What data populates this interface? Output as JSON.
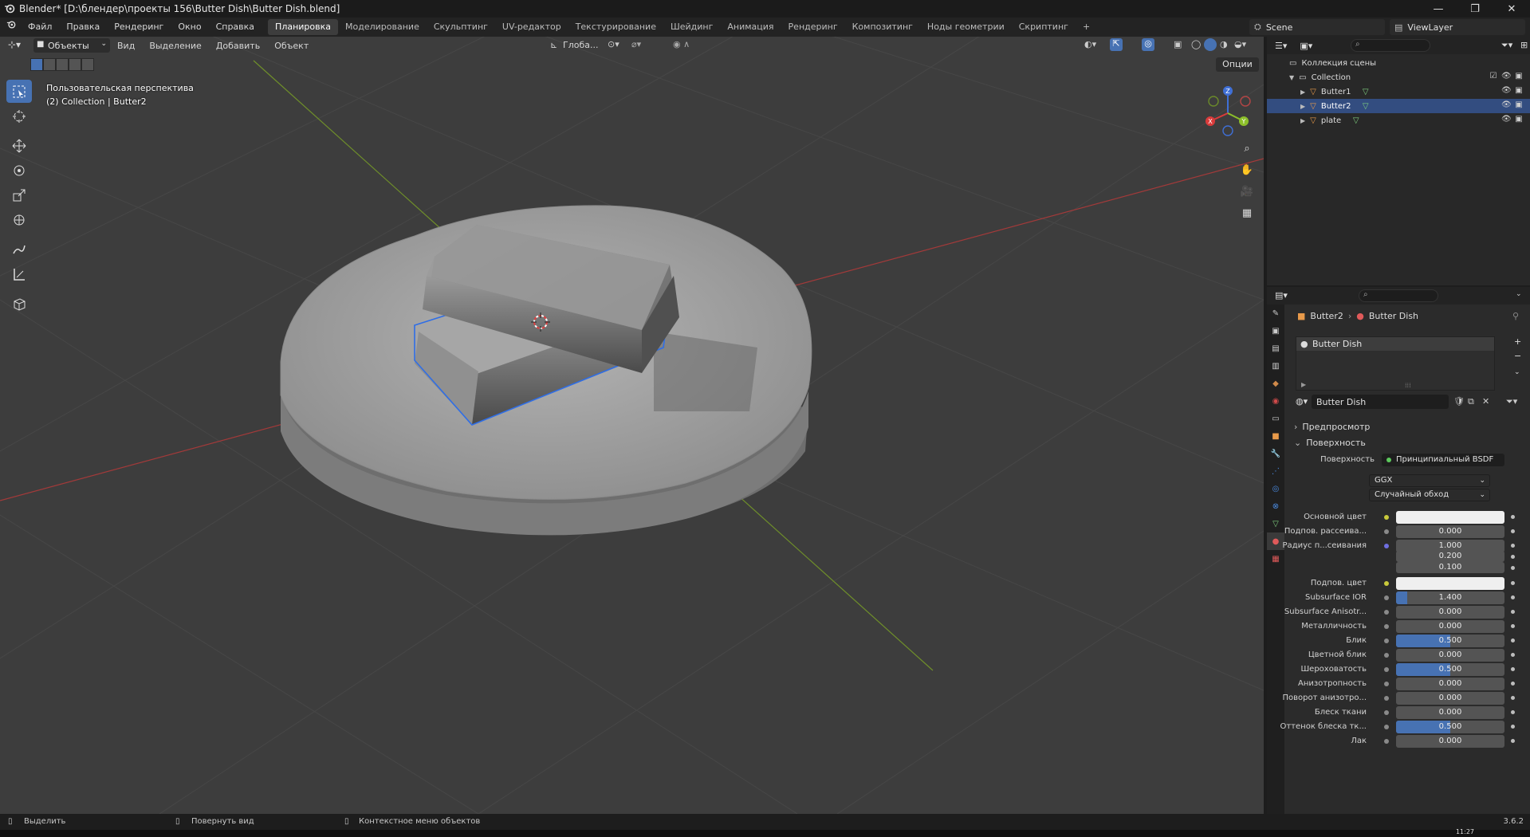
{
  "window": {
    "title": "Blender* [D:\\блендер\\проекты 156\\Butter Dish\\Butter Dish.blend]",
    "controls": [
      "—",
      "❐",
      "✕"
    ]
  },
  "menu": [
    "Файл",
    "Правка",
    "Рендеринг",
    "Окно",
    "Справка"
  ],
  "workspaces": {
    "active": "Планировка",
    "tabs": [
      "Моделирование",
      "Скульптинг",
      "UV-редактор",
      "Текстурирование",
      "Шейдинг",
      "Анимация",
      "Рендеринг",
      "Композитинг",
      "Ноды геометрии",
      "Скриптинг"
    ],
    "add": "+"
  },
  "scene": {
    "name": "Scene",
    "view_layer": "ViewLayer"
  },
  "viewport": {
    "mode": "Объекты",
    "menus": [
      "Вид",
      "Выделение",
      "Добавить",
      "Объект"
    ],
    "transform_orientation": "Глоба...",
    "options_label": "Опции",
    "info_line1": "Пользовательская перспектива",
    "info_line2": "(2) Collection | Butter2",
    "gizmo_axes": {
      "x": "X",
      "y": "Y",
      "z": "Z"
    }
  },
  "toolbar": {
    "tools": [
      "select-box",
      "cursor",
      "move",
      "rotate",
      "scale",
      "transform",
      "annotate",
      "measure",
      "add-cube"
    ],
    "active": "select-box"
  },
  "outliner": {
    "root": "Коллекция сцены",
    "collection": "Collection",
    "objects": [
      {
        "name": "Butter1",
        "selected": false
      },
      {
        "name": "Butter2",
        "selected": true
      },
      {
        "name": "plate",
        "selected": false
      }
    ]
  },
  "properties": {
    "breadcrumb_object": "Butter2",
    "breadcrumb_material": "Butter Dish",
    "slot_name": "Butter Dish",
    "material_name": "Butter Dish",
    "panels": {
      "preview": "Предпросмотр",
      "surface": "Поверхность"
    },
    "surface_label": "Поверхность",
    "surface_shader": "Принципиальный BSDF",
    "distribution": "GGX",
    "subsurface_method": "Случайный обход",
    "rows": [
      {
        "label": "Основной цвет",
        "value": "",
        "type": "color",
        "dot": "yellow"
      },
      {
        "label": "Подпов. рассеива...",
        "value": "0.000",
        "type": "num",
        "dot": "grey"
      },
      {
        "label": "Радиус п...сеивания",
        "value": "1.000",
        "type": "num",
        "dot": "blue"
      },
      {
        "label": "",
        "value": "0.200",
        "type": "num",
        "dot": ""
      },
      {
        "label": "",
        "value": "0.100",
        "type": "num",
        "dot": ""
      },
      {
        "label": "Подпов. цвет",
        "value": "",
        "type": "color",
        "dot": "yellow"
      },
      {
        "label": "Subsurface IOR",
        "value": "1.400",
        "type": "num",
        "dot": "grey",
        "fill": 0.1
      },
      {
        "label": "Subsurface Anisotr...",
        "value": "0.000",
        "type": "num",
        "dot": "grey"
      },
      {
        "label": "Металличность",
        "value": "0.000",
        "type": "num",
        "dot": "grey"
      },
      {
        "label": "Блик",
        "value": "0.500",
        "type": "num",
        "dot": "grey",
        "fill": 0.5
      },
      {
        "label": "Цветной блик",
        "value": "0.000",
        "type": "num",
        "dot": "grey"
      },
      {
        "label": "Шероховатость",
        "value": "0.500",
        "type": "num",
        "dot": "grey",
        "fill": 0.5
      },
      {
        "label": "Анизотропность",
        "value": "0.000",
        "type": "num",
        "dot": "grey"
      },
      {
        "label": "Поворот анизотро...",
        "value": "0.000",
        "type": "num",
        "dot": "grey"
      },
      {
        "label": "Блеск ткани",
        "value": "0.000",
        "type": "num",
        "dot": "grey"
      },
      {
        "label": "Оттенок блеска тк...",
        "value": "0.500",
        "type": "num",
        "dot": "grey",
        "fill": 0.5
      },
      {
        "label": "Лак",
        "value": "0.000",
        "type": "num",
        "dot": "grey"
      }
    ]
  },
  "status": {
    "select": "Выделить",
    "rotate_view": "Повернуть вид",
    "context_menu": "Контекстное меню объектов",
    "version": "3.6.2",
    "clock": "11:27"
  },
  "colors": {
    "accent": "#4772b3",
    "selection_outline": "#2f6ee6",
    "x_axis": "#d93b3b",
    "y_axis": "#8cbf2a"
  }
}
